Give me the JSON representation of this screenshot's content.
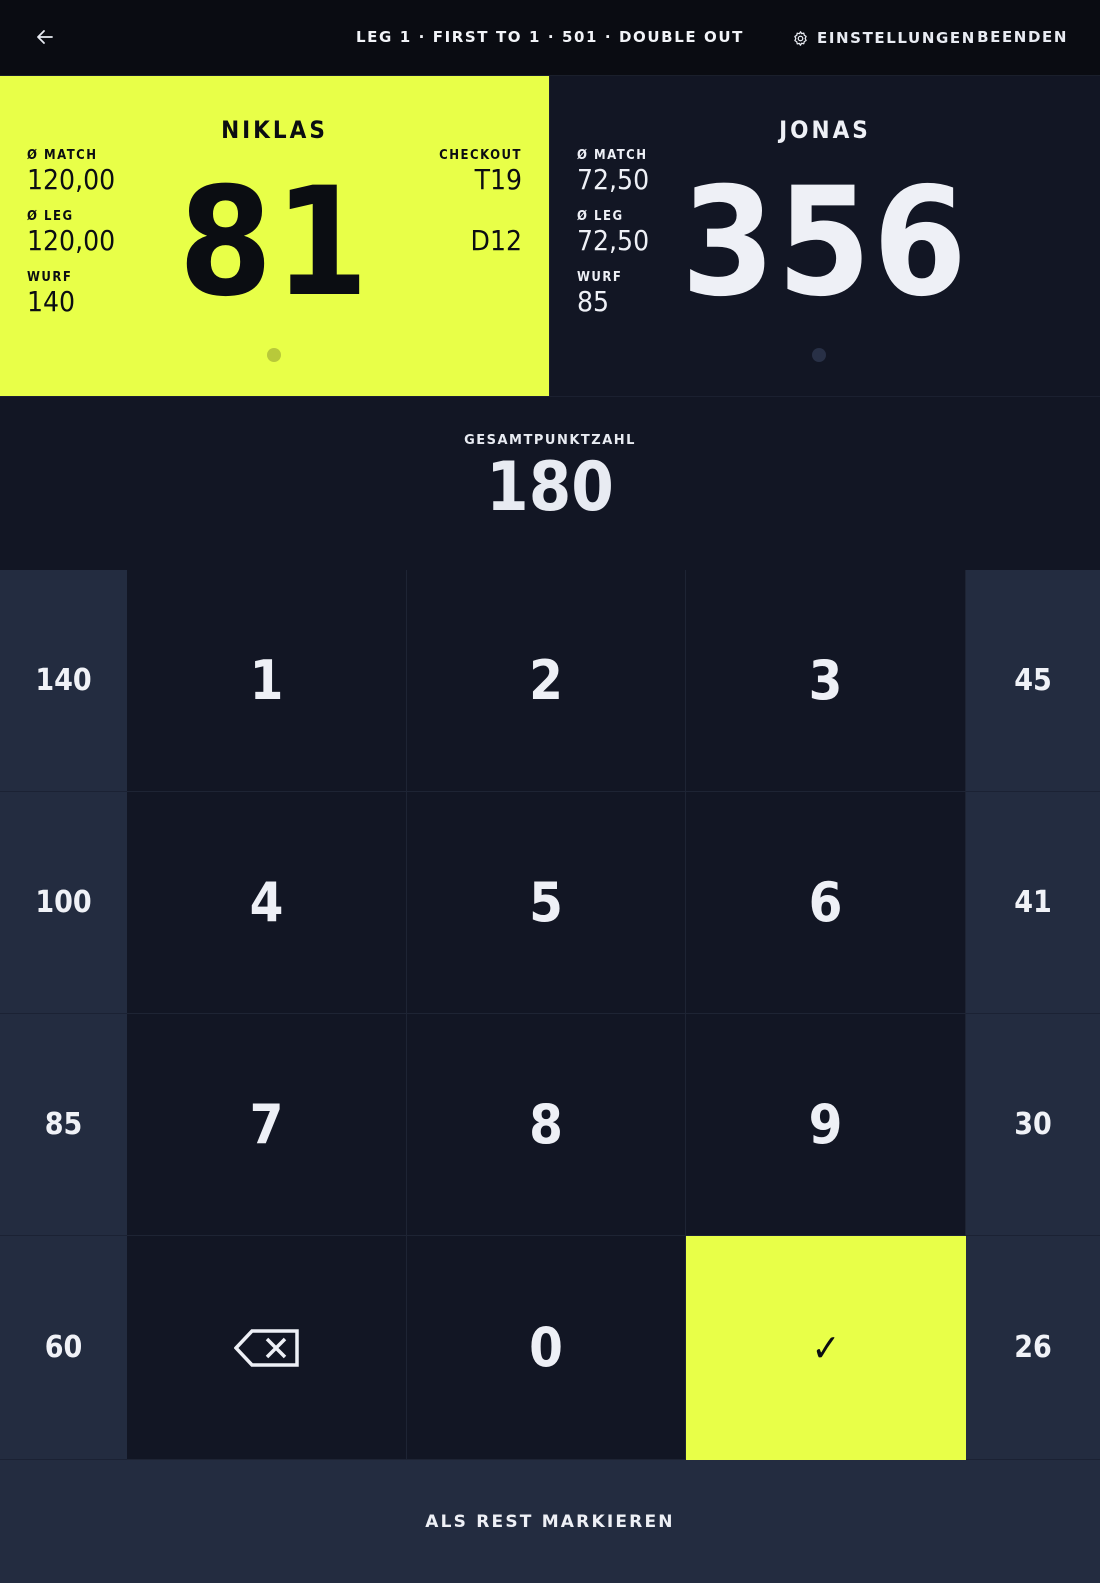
{
  "header": {
    "title": "LEG 1 · FIRST TO 1 · 501 · DOUBLE OUT",
    "settings_label": "EINSTELLUNGEN",
    "end_label": "BEENDEN"
  },
  "players": [
    {
      "name": "NIKLAS",
      "score": "81",
      "active": true,
      "stats": [
        {
          "label": "Ø MATCH",
          "value": "120,00"
        },
        {
          "label": "Ø LEG",
          "value": "120,00"
        },
        {
          "label": "WURF",
          "value": "140"
        }
      ],
      "checkout_label": "CHECKOUT",
      "checkout": [
        "T19",
        "D12"
      ]
    },
    {
      "name": "JONAS",
      "score": "356",
      "active": false,
      "stats": [
        {
          "label": "Ø MATCH",
          "value": "72,50"
        },
        {
          "label": "Ø LEG",
          "value": "72,50"
        },
        {
          "label": "WURF",
          "value": "85"
        }
      ]
    }
  ],
  "total": {
    "label": "GESAMTPUNKTZAHL",
    "value": "180"
  },
  "keypad": {
    "quick_left": [
      "140",
      "100",
      "85",
      "60"
    ],
    "quick_right": [
      "45",
      "41",
      "30",
      "26"
    ],
    "digits": [
      "1",
      "2",
      "3",
      "4",
      "5",
      "6",
      "7",
      "8",
      "9"
    ],
    "zero": "0",
    "confirm": "✓"
  },
  "rest_label": "ALS REST MARKIEREN",
  "colors": {
    "accent": "#e8ff48",
    "panel": "#121624",
    "quick": "#232c40",
    "topbar": "#0a0c12"
  },
  "icons": {
    "back": "arrow-left-icon",
    "settings": "gear-icon",
    "backspace": "backspace-icon",
    "confirm": "check-icon"
  }
}
